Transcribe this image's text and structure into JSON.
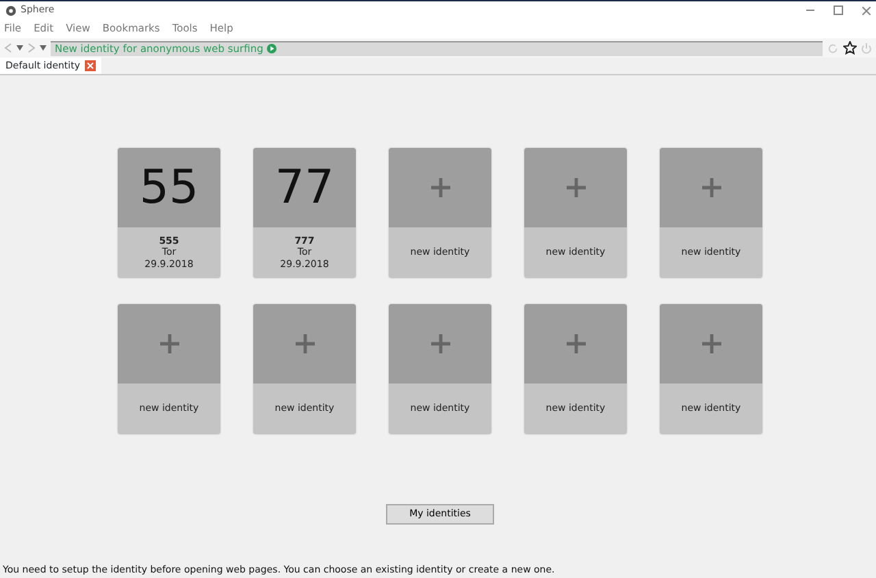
{
  "window": {
    "title": "Sphere"
  },
  "menu": [
    "File",
    "Edit",
    "View",
    "Bookmarks",
    "Tools",
    "Help"
  ],
  "address_bar": {
    "value": "New identity for anonymous web surfing"
  },
  "tabs": [
    {
      "label": "Default identity",
      "selected": true
    }
  ],
  "identities": [
    {
      "kind": "identity",
      "number": "55",
      "name": "555",
      "type": "Tor",
      "date": "29.9.2018"
    },
    {
      "kind": "identity",
      "number": "77",
      "name": "777",
      "type": "Tor",
      "date": "29.9.2018"
    },
    {
      "kind": "new",
      "label": "new identity"
    },
    {
      "kind": "new",
      "label": "new identity"
    },
    {
      "kind": "new",
      "label": "new identity"
    },
    {
      "kind": "new",
      "label": "new identity"
    },
    {
      "kind": "new",
      "label": "new identity"
    },
    {
      "kind": "new",
      "label": "new identity"
    },
    {
      "kind": "new",
      "label": "new identity"
    },
    {
      "kind": "new",
      "label": "new identity"
    }
  ],
  "my_identities_button": "My identities",
  "status_message": "You need to setup the identity before opening web pages. You can choose an existing identity or create a new one."
}
